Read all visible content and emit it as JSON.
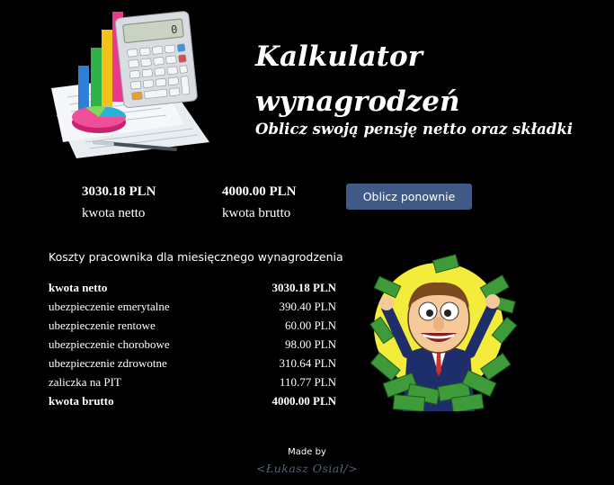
{
  "header": {
    "title_line1": "Kalkulator",
    "title_line2": "wynagrodzeń",
    "subtitle": "Oblicz swoją pensję netto oraz składki",
    "calculator_display": "0"
  },
  "summary": {
    "net_value": "3030.18 PLN",
    "net_label": "kwota netto",
    "gross_value": "4000.00 PLN",
    "gross_label": "kwota brutto",
    "recalc_button": "Oblicz ponownie"
  },
  "costs": {
    "heading": "Koszty pracownika dla miesięcznego wynagrodzenia",
    "rows": [
      {
        "label": "kwota netto",
        "value": "3030.18 PLN"
      },
      {
        "label": "ubezpieczenie emerytalne",
        "value": "390.40 PLN"
      },
      {
        "label": "ubezpieczenie rentowe",
        "value": "60.00 PLN"
      },
      {
        "label": "ubezpieczenie chorobowe",
        "value": "98.00 PLN"
      },
      {
        "label": "ubezpieczenie zdrowotne",
        "value": "310.64 PLN"
      },
      {
        "label": "zaliczka na PIT",
        "value": "110.77 PLN"
      },
      {
        "label": "kwota brutto",
        "value": "4000.00 PLN"
      }
    ]
  },
  "footer": {
    "made_by": "Made by",
    "author": "<Łukasz Osiał/>"
  },
  "colors": {
    "background": "#000000",
    "button": "#3f5a86",
    "author_text": "#55607a",
    "illustration_circle": "#f4ec3a",
    "money_green": "#3f9a3a"
  }
}
